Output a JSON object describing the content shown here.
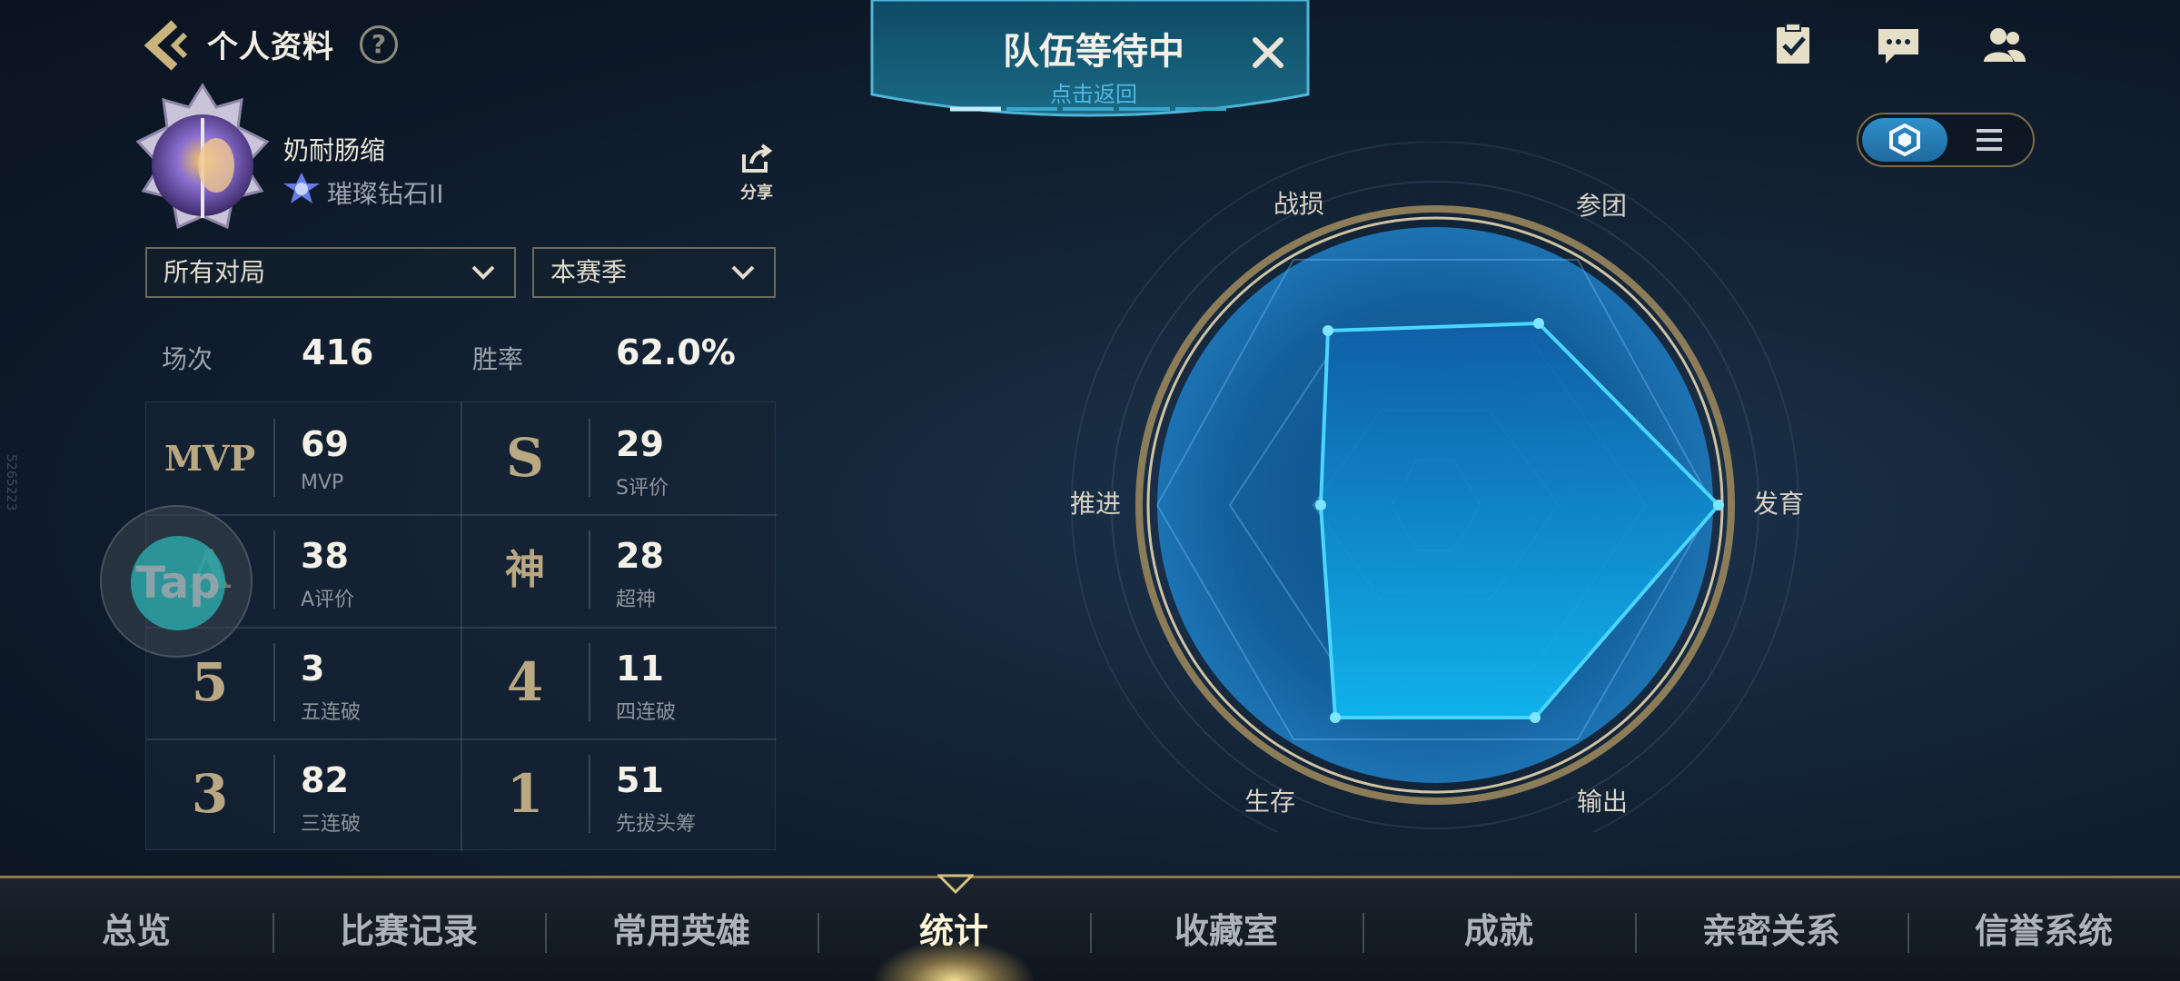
{
  "header": {
    "title": "个人资料",
    "help_icon": "?"
  },
  "profile": {
    "name": "奶耐肠缩",
    "rank": "璀璨钻石II",
    "share_label": "分享"
  },
  "filters": {
    "mode": "所有对局",
    "season": "本赛季"
  },
  "summary": {
    "matches_label": "场次",
    "matches_value": "416",
    "winrate_label": "胜率",
    "winrate_value": "62.0%"
  },
  "stats": [
    {
      "icon": "MVP",
      "value": "69",
      "label": "MVP"
    },
    {
      "icon": "S",
      "value": "29",
      "label": "S评价"
    },
    {
      "icon": "A",
      "value": "38",
      "label": "A评价"
    },
    {
      "icon": "神",
      "value": "28",
      "label": "超神"
    },
    {
      "icon": "5",
      "value": "3",
      "label": "五连破"
    },
    {
      "icon": "4",
      "value": "11",
      "label": "四连破"
    },
    {
      "icon": "3",
      "value": "82",
      "label": "三连破"
    },
    {
      "icon": "1",
      "value": "51",
      "label": "先拔头筹"
    }
  ],
  "overlay": {
    "tap_text": "Tap",
    "watermark": "5265223"
  },
  "queue": {
    "title": "队伍等待中",
    "subtitle": "点击返回"
  },
  "top_icons": [
    "task-icon",
    "chat-icon",
    "friends-icon"
  ],
  "radar": {
    "labels": {
      "top_left": "战损",
      "top_right": "参团",
      "right": "发育",
      "bottom_right": "输出",
      "bottom_left": "生存",
      "left": "推进"
    }
  },
  "nav": {
    "items": [
      "总览",
      "比赛记录",
      "常用英雄",
      "统计",
      "收藏室",
      "成就",
      "亲密关系",
      "信誉系统"
    ],
    "active": "统计"
  },
  "colors": {
    "accent_gold": "#b9a882",
    "accent_blue": "#1f8fd8",
    "radar_line": "#4ad6ff"
  }
}
